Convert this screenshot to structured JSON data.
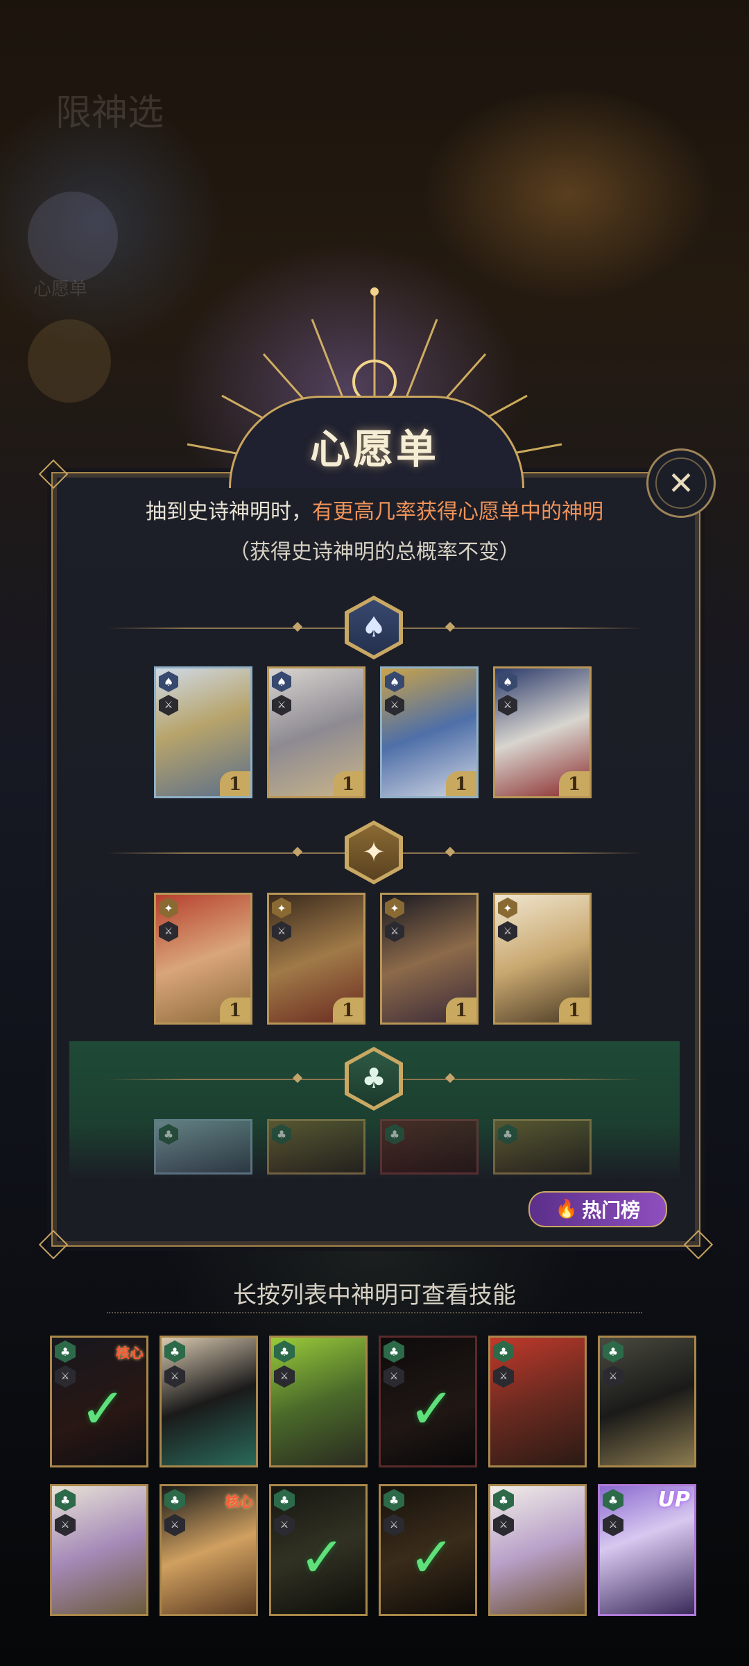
{
  "background": {
    "blurred_labels": [
      "限神选",
      "心愿单"
    ]
  },
  "dialog": {
    "title": "心愿单",
    "close_icon": "close-x-icon",
    "description_prefix": "抽到史诗神明时，",
    "description_highlight": "有更高几率获得心愿单中的神明",
    "description_note": "（获得史诗神明的总概率不变）",
    "highlight_color": "#f0935a",
    "tiers": [
      {
        "icon": "spade-icon",
        "glyph": "♠",
        "color": "#384970",
        "cards": [
          {
            "name": "blonde-goddess",
            "rank": "1",
            "frame": "blue",
            "suit": "♠"
          },
          {
            "name": "silver-queen",
            "rank": "1",
            "frame": "gold",
            "suit": "♠"
          },
          {
            "name": "bearded-king",
            "rank": "1",
            "frame": "blue",
            "suit": "♠"
          },
          {
            "name": "masked-jester",
            "rank": "1",
            "frame": "gold",
            "suit": "♠"
          }
        ]
      },
      {
        "icon": "diamond-star-icon",
        "glyph": "✦",
        "color": "#8a6a33",
        "cards": [
          {
            "name": "red-haired-lady",
            "rank": "1",
            "frame": "gold",
            "suit": "✦"
          },
          {
            "name": "warrior-lord",
            "rank": "1",
            "frame": "gold",
            "suit": "✦"
          },
          {
            "name": "dark-haired-lady",
            "rank": "1",
            "frame": "gold",
            "suit": "✦"
          },
          {
            "name": "white-haired-lady",
            "rank": "1",
            "frame": "gold",
            "suit": "✦"
          }
        ]
      },
      {
        "icon": "club-icon",
        "glyph": "♣",
        "color": "#2e5a44",
        "cards": [
          {
            "name": "faded-card-1",
            "suit": "♣"
          },
          {
            "name": "faded-card-2",
            "suit": "♣"
          },
          {
            "name": "faded-card-3",
            "suit": "♣"
          },
          {
            "name": "faded-card-4",
            "suit": "♣"
          }
        ]
      }
    ],
    "hot_button_label": "热门榜",
    "hot_button_icon": "flame-icon"
  },
  "hint": "长按列表中神明可查看技能",
  "roster": {
    "core_label": "核心",
    "up_label": "UP",
    "cards": [
      {
        "name": "roster-dark-robed",
        "selected": true,
        "core": true,
        "up": false
      },
      {
        "name": "roster-black-hair-flowers",
        "selected": false,
        "core": false,
        "up": false
      },
      {
        "name": "roster-green-hair",
        "selected": false,
        "core": false,
        "up": false
      },
      {
        "name": "roster-shadow-figure",
        "selected": true,
        "core": false,
        "up": false
      },
      {
        "name": "roster-red-hair",
        "selected": false,
        "core": false,
        "up": false
      },
      {
        "name": "roster-horned-helm",
        "selected": false,
        "core": false,
        "up": false
      },
      {
        "name": "roster-silver-crown",
        "selected": false,
        "core": false,
        "up": false
      },
      {
        "name": "roster-black-hair-gold",
        "selected": false,
        "core": true,
        "up": false
      },
      {
        "name": "roster-dark-lady",
        "selected": true,
        "core": false,
        "up": false
      },
      {
        "name": "roster-dark-man",
        "selected": true,
        "core": false,
        "up": false
      },
      {
        "name": "roster-white-hair",
        "selected": false,
        "core": false,
        "up": false
      },
      {
        "name": "roster-purple-frame",
        "selected": false,
        "core": false,
        "up": true
      }
    ]
  }
}
